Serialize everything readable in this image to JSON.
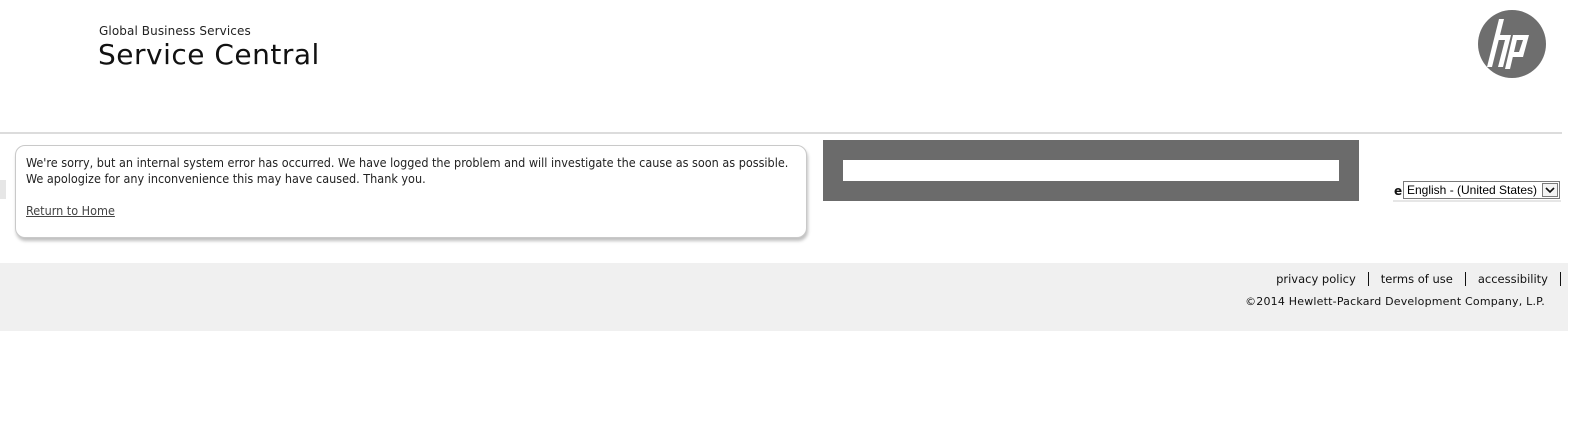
{
  "header": {
    "subtitle": "Global Business Services",
    "title": "Service Central",
    "logo": {
      "icon": "hp-logo-icon",
      "text": "hp",
      "color": "#6e6e6e"
    }
  },
  "error": {
    "line1": "We're sorry, but an internal system error has occurred. We have logged the problem and will investigate the cause as soon as possible.",
    "line2": "We apologize for any inconvenience this may have caused. Thank you.",
    "return_link": "Return to Home"
  },
  "search": {
    "value": "",
    "frame_color": "#6b6b6b"
  },
  "language": {
    "prefix": "e",
    "selected": "English - (United States)",
    "icon": "chevron-down-icon"
  },
  "footer": {
    "links": [
      "privacy policy",
      "terms of use",
      "accessibility"
    ],
    "copyright": "©2014 Hewlett-Packard Development Company, L.P.",
    "background": "#f0f0f0"
  }
}
